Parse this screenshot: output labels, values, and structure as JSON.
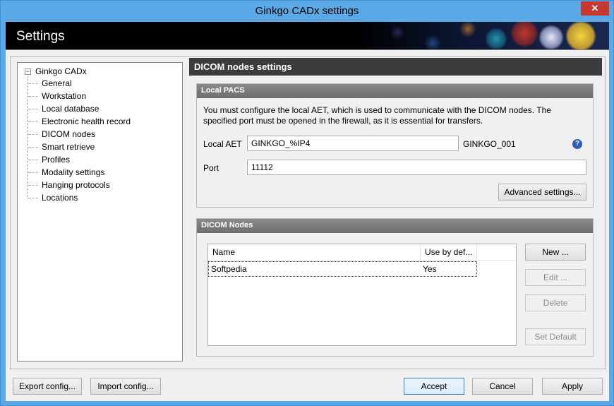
{
  "window": {
    "title": "Ginkgo CADx settings",
    "close_glyph": "✕"
  },
  "banner": {
    "heading": "Settings"
  },
  "tree": {
    "root": "Ginkgo CADx",
    "toggle_glyph": "−",
    "items": [
      "General",
      "Workstation",
      "Local database",
      "Electronic health record",
      "DICOM nodes",
      "Smart retrieve",
      "Profiles",
      "Modality settings",
      "Hanging protocols",
      "Locations"
    ]
  },
  "content": {
    "header": "DICOM nodes settings",
    "local_pacs": {
      "title": "Local PACS",
      "description": "You must configure the local AET, which is used to communicate with the DICOM nodes. The specified port must be opened in the firewall, as it is essential for transfers.",
      "aet_label": "Local AET",
      "aet_value": "GINKGO_%IP4",
      "aet_resolved": "GINKGO_001",
      "port_label": "Port",
      "port_value": "11112",
      "help_glyph": "?",
      "advanced_button": "Advanced settings..."
    },
    "dicom_nodes": {
      "title": "DICOM Nodes",
      "columns": [
        "Name",
        "Use by def..."
      ],
      "rows": [
        {
          "name": "Softpedia",
          "default": "Yes"
        }
      ],
      "new_button": "New ...",
      "edit_button": "Edit ...",
      "delete_button": "Delete",
      "set_default_button": "Set Default"
    }
  },
  "footer": {
    "export_button": "Export config...",
    "import_button": "Import config...",
    "accept_button": "Accept",
    "cancel_button": "Cancel",
    "apply_button": "Apply"
  }
}
